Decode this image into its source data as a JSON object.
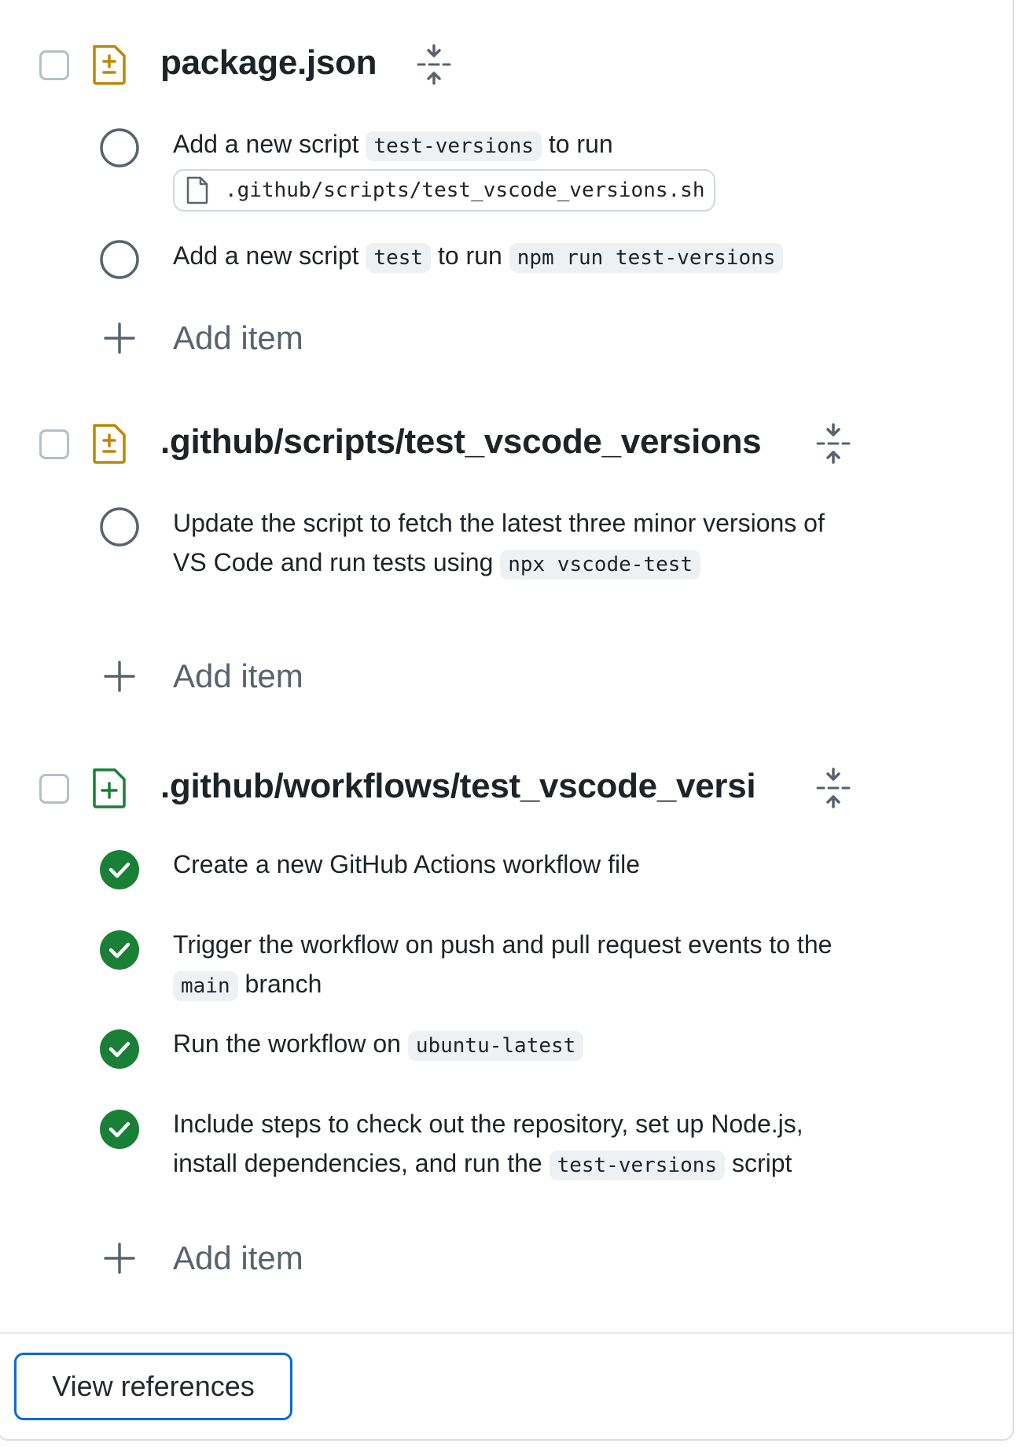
{
  "files": [
    {
      "name": "package.json",
      "icon": "file-diff-icon",
      "icon_color": "#bf8700",
      "items": [
        {
          "status": "pending",
          "parts": [
            {
              "t": "Add a new script "
            },
            {
              "code": "test-versions"
            },
            {
              "t": " to run"
            }
          ],
          "file_ref": ".github/scripts/test_vscode_versions.sh"
        },
        {
          "status": "pending",
          "parts": [
            {
              "t": "Add a new script "
            },
            {
              "code": "test"
            },
            {
              "t": " to run "
            },
            {
              "code": "npm run test-versions"
            }
          ]
        }
      ],
      "add_label": "Add item"
    },
    {
      "name": ".github/scripts/test_vscode_versions",
      "icon": "file-diff-icon",
      "icon_color": "#bf8700",
      "items": [
        {
          "status": "pending",
          "parts": [
            {
              "t": "Update the script to fetch the latest three minor versions of VS Code and run tests using "
            },
            {
              "code": "npx vscode-test"
            }
          ]
        }
      ],
      "add_label": "Add item"
    },
    {
      "name": ".github/workflows/test_vscode_versi",
      "icon": "file-added-icon",
      "icon_color": "#1a7f37",
      "items": [
        {
          "status": "done",
          "parts": [
            {
              "t": "Create a new GitHub Actions workflow file"
            }
          ]
        },
        {
          "status": "done",
          "parts": [
            {
              "t": "Trigger the workflow on push and pull request events to the "
            },
            {
              "code": "main"
            },
            {
              "t": " branch"
            }
          ]
        },
        {
          "status": "done",
          "parts": [
            {
              "t": "Run the workflow on "
            },
            {
              "code": "ubuntu-latest"
            }
          ]
        },
        {
          "status": "done",
          "parts": [
            {
              "t": "Include steps to check out the repository, set up Node.js, install dependencies, and run the "
            },
            {
              "code": "test-versions"
            },
            {
              "t": " script"
            }
          ]
        }
      ],
      "add_label": "Add item"
    }
  ],
  "footer": {
    "view_references_label": "View references"
  },
  "colors": {
    "accent": "#0969da",
    "done_green": "#1a7f37",
    "pending_gray": "#59636e",
    "code_bg": "#eef1f4"
  }
}
